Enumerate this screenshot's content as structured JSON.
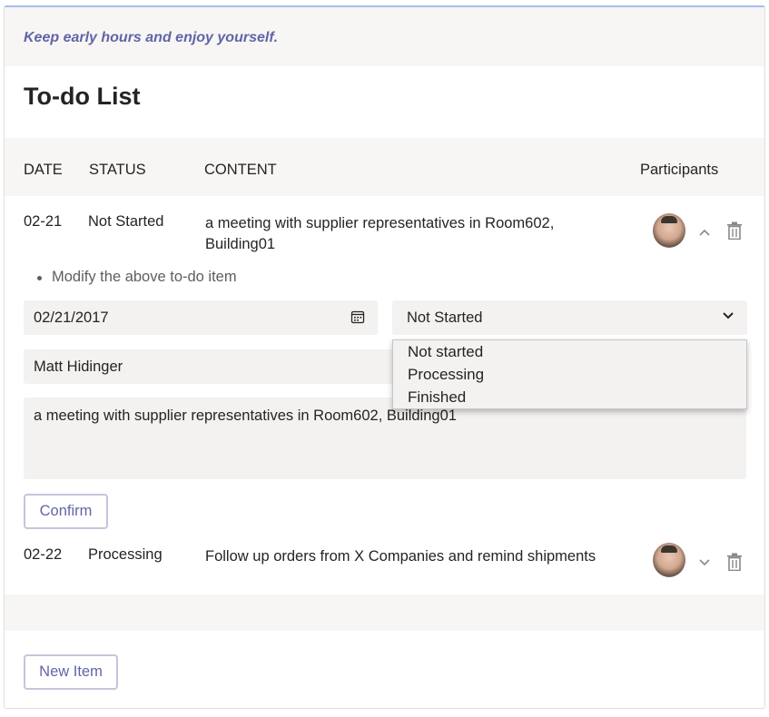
{
  "tip": "Keep early hours and enjoy yourself.",
  "title": "To-do List",
  "table": {
    "headers": [
      "DATE",
      "STATUS",
      "CONTENT",
      "Participants"
    ],
    "rows": [
      {
        "date": "02-21",
        "status": "Not Started",
        "content": "a meeting with supplier representatives in Room602, Building01",
        "expanded": true
      },
      {
        "date": "02-22",
        "status": "Processing",
        "content": "Follow up orders from X Companies and remind shipments",
        "expanded": false
      }
    ]
  },
  "editor": {
    "hint": "Modify the above to-do item",
    "date_value": "02/21/2017",
    "status_value": "Not Started",
    "status_options": [
      "Not started",
      "Processing",
      "Finished"
    ],
    "participant_value": "Matt Hidinger",
    "content_value": "a meeting with supplier representatives in Room602, Building01",
    "confirm_label": "Confirm"
  },
  "new_item_label": "New Item",
  "colors": {
    "accent": "#6264a7",
    "panel_bg": "#f7f6f5",
    "field_bg": "#f3f2f1",
    "border_top": "#a6bcec"
  }
}
